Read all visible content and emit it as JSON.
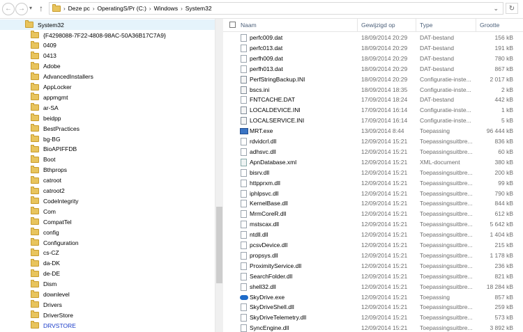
{
  "address": {
    "crumbs": [
      "Deze pc",
      "OperatingS/Pr (C:)",
      "Windows",
      "System32"
    ],
    "nav_back": "←",
    "nav_forward": "→",
    "nav_up": "↑"
  },
  "tree": {
    "root": "System32",
    "items": [
      "{F4298088-7F22-4808-98AC-50A36B17C7A9}",
      "0409",
      "0413",
      "Adobe",
      "AdvancedInstallers",
      "AppLocker",
      "appmgmt",
      "ar-SA",
      "beidpp",
      "BestPractices",
      "bg-BG",
      "BioAPIFFDB",
      "Boot",
      "Bthprops",
      "catroot",
      "catroot2",
      "CodeIntegrity",
      "Com",
      "CompatTel",
      "config",
      "Configuration",
      "cs-CZ",
      "da-DK",
      "de-DE",
      "Dism",
      "downlevel",
      "Drivers",
      "DriverStore",
      "DRVSTORE"
    ],
    "selected_index": 28
  },
  "list": {
    "headers": {
      "name": "Naam",
      "date": "Gewijzigd op",
      "type": "Type",
      "size": "Grootte"
    },
    "files": [
      {
        "icon": "file",
        "name": "perfc009.dat",
        "date": "18/09/2014 20:29",
        "type": "DAT-bestand",
        "size": "156 kB"
      },
      {
        "icon": "file",
        "name": "perfc013.dat",
        "date": "18/09/2014 20:29",
        "type": "DAT-bestand",
        "size": "191 kB"
      },
      {
        "icon": "file",
        "name": "perfh009.dat",
        "date": "18/09/2014 20:29",
        "type": "DAT-bestand",
        "size": "780 kB"
      },
      {
        "icon": "file",
        "name": "perfh013.dat",
        "date": "18/09/2014 20:29",
        "type": "DAT-bestand",
        "size": "867 kB"
      },
      {
        "icon": "cfg",
        "name": "PerfStringBackup.INI",
        "date": "18/09/2014 20:29",
        "type": "Configuratie-inste...",
        "size": "2 017 kB"
      },
      {
        "icon": "cfg",
        "name": "bscs.ini",
        "date": "18/09/2014 18:35",
        "type": "Configuratie-inste...",
        "size": "2 kB"
      },
      {
        "icon": "file",
        "name": "FNTCACHE.DAT",
        "date": "17/09/2014 18:24",
        "type": "DAT-bestand",
        "size": "442 kB"
      },
      {
        "icon": "cfg",
        "name": "LOCALDEVICE.INI",
        "date": "17/09/2014 16:14",
        "type": "Configuratie-inste...",
        "size": "1 kB"
      },
      {
        "icon": "cfg",
        "name": "LOCALSERVICE.INI",
        "date": "17/09/2014 16:14",
        "type": "Configuratie-inste...",
        "size": "5 kB"
      },
      {
        "icon": "exe",
        "name": "MRT.exe",
        "date": "13/09/2014 8:44",
        "type": "Toepassing",
        "size": "96 444 kB"
      },
      {
        "icon": "file",
        "name": "rdvidcrl.dll",
        "date": "12/09/2014 15:21",
        "type": "Toepassingsuitbre...",
        "size": "836 kB"
      },
      {
        "icon": "file",
        "name": "adhsvc.dll",
        "date": "12/09/2014 15:21",
        "type": "Toepassingsuitbre...",
        "size": "60 kB"
      },
      {
        "icon": "xml",
        "name": "ApnDatabase.xml",
        "date": "12/09/2014 15:21",
        "type": "XML-document",
        "size": "380 kB"
      },
      {
        "icon": "file",
        "name": "bisrv.dll",
        "date": "12/09/2014 15:21",
        "type": "Toepassingsuitbre...",
        "size": "200 kB"
      },
      {
        "icon": "file",
        "name": "httpprxm.dll",
        "date": "12/09/2014 15:21",
        "type": "Toepassingsuitbre...",
        "size": "99 kB"
      },
      {
        "icon": "file",
        "name": "iphlpsvc.dll",
        "date": "12/09/2014 15:21",
        "type": "Toepassingsuitbre...",
        "size": "790 kB"
      },
      {
        "icon": "file",
        "name": "KernelBase.dll",
        "date": "12/09/2014 15:21",
        "type": "Toepassingsuitbre...",
        "size": "844 kB"
      },
      {
        "icon": "file",
        "name": "MrmCoreR.dll",
        "date": "12/09/2014 15:21",
        "type": "Toepassingsuitbre...",
        "size": "612 kB"
      },
      {
        "icon": "file",
        "name": "mstscax.dll",
        "date": "12/09/2014 15:21",
        "type": "Toepassingsuitbre...",
        "size": "5 642 kB"
      },
      {
        "icon": "file",
        "name": "ntdll.dll",
        "date": "12/09/2014 15:21",
        "type": "Toepassingsuitbre...",
        "size": "1 404 kB"
      },
      {
        "icon": "file",
        "name": "pcsvDevice.dll",
        "date": "12/09/2014 15:21",
        "type": "Toepassingsuitbre...",
        "size": "215 kB"
      },
      {
        "icon": "file",
        "name": "propsys.dll",
        "date": "12/09/2014 15:21",
        "type": "Toepassingsuitbre...",
        "size": "1 178 kB"
      },
      {
        "icon": "file",
        "name": "ProximityService.dll",
        "date": "12/09/2014 15:21",
        "type": "Toepassingsuitbre...",
        "size": "236 kB"
      },
      {
        "icon": "file",
        "name": "SearchFolder.dll",
        "date": "12/09/2014 15:21",
        "type": "Toepassingsuitbre...",
        "size": "821 kB"
      },
      {
        "icon": "file",
        "name": "shell32.dll",
        "date": "12/09/2014 15:21",
        "type": "Toepassingsuitbre...",
        "size": "18 284 kB"
      },
      {
        "icon": "cloud",
        "name": "SkyDrive.exe",
        "date": "12/09/2014 15:21",
        "type": "Toepassing",
        "size": "857 kB"
      },
      {
        "icon": "file",
        "name": "SkyDriveShell.dll",
        "date": "12/09/2014 15:21",
        "type": "Toepassingsuitbre...",
        "size": "259 kB"
      },
      {
        "icon": "file",
        "name": "SkyDriveTelemetry.dll",
        "date": "12/09/2014 15:21",
        "type": "Toepassingsuitbre...",
        "size": "573 kB"
      },
      {
        "icon": "file",
        "name": "SyncEngine.dll",
        "date": "12/09/2014 15:21",
        "type": "Toepassingsuitbre...",
        "size": "3 892 kB"
      }
    ]
  }
}
